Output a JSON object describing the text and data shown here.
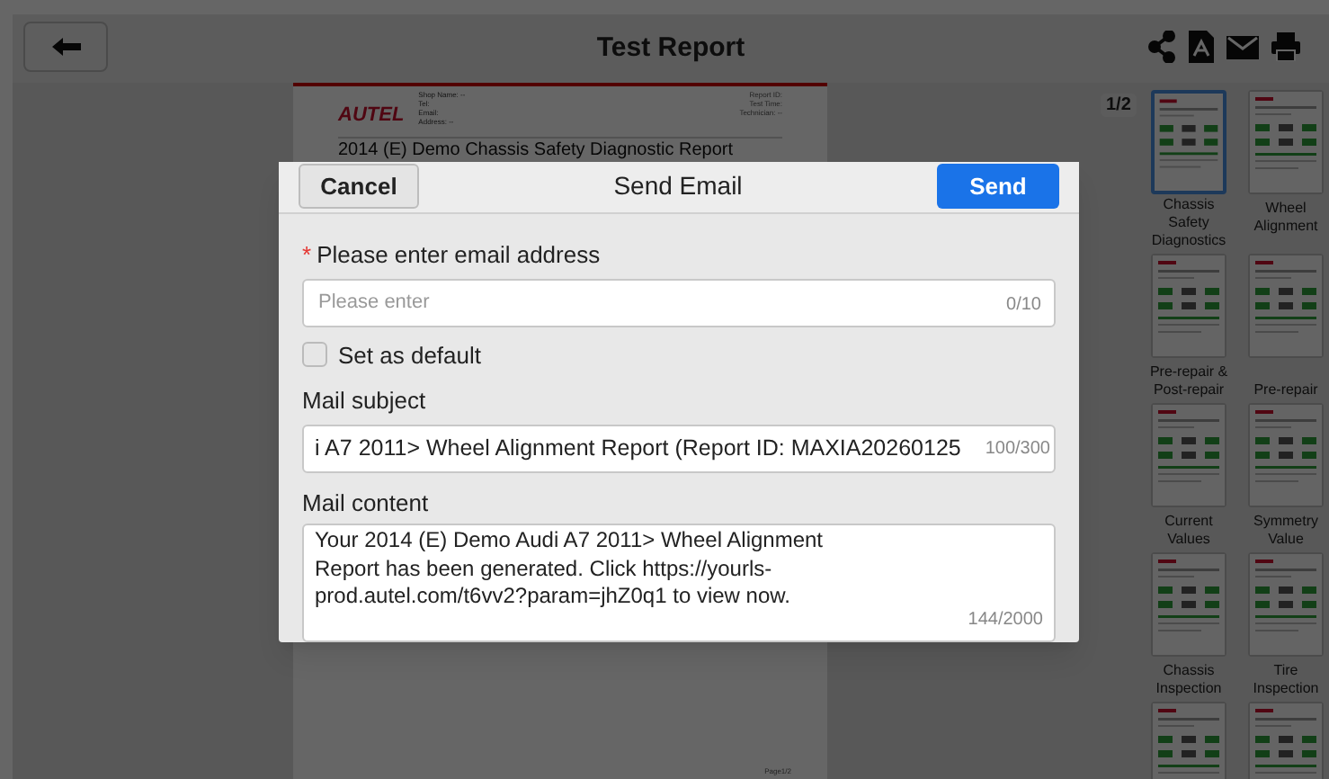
{
  "top_bar": {
    "title": "Test Report"
  },
  "report": {
    "logo": "AUTEL",
    "shop_fields": [
      "Shop Name: --",
      "Tel:",
      "Email:",
      "Address: --"
    ],
    "meta_fields": [
      "Report ID:",
      "Test Time:",
      "Technician: --"
    ],
    "title": "2014 (E) Demo Chassis Safety Diagnostic Report",
    "footer_page": "Page1/2"
  },
  "page_indicator": "1/2",
  "thumbnails": [
    {
      "label": "Chassis Safety Diagnostics",
      "selected": true
    },
    {
      "label": "Wheel Alignment",
      "selected": false
    },
    {
      "label": "Pre-repair & Post-repair",
      "selected": false
    },
    {
      "label": "Pre-repair",
      "selected": false
    },
    {
      "label": "Current Values",
      "selected": false
    },
    {
      "label": "Symmetry Value",
      "selected": false
    },
    {
      "label": "Chassis Inspection",
      "selected": false
    },
    {
      "label": "Tire Inspection",
      "selected": false
    }
  ],
  "dialog": {
    "title": "Send Email",
    "cancel": "Cancel",
    "send": "Send",
    "email": {
      "required_mark": "*",
      "label": "Please enter email address",
      "placeholder": "Please enter",
      "counter": "0/10"
    },
    "set_default": {
      "label": "Set as default",
      "checked": false
    },
    "subject": {
      "label": "Mail subject",
      "value": "i A7 2011> Wheel Alignment Report (Report ID: MAXIA20260125",
      "counter": "100/300"
    },
    "content": {
      "label": "Mail content",
      "value": "Your 2014 (E) Demo Audi A7 2011> Wheel Alignment Report has been generated. Click https://yourls-prod.autel.com/t6vv2?param=jhZ0q1  to view now.",
      "counter": "144/2000"
    }
  }
}
